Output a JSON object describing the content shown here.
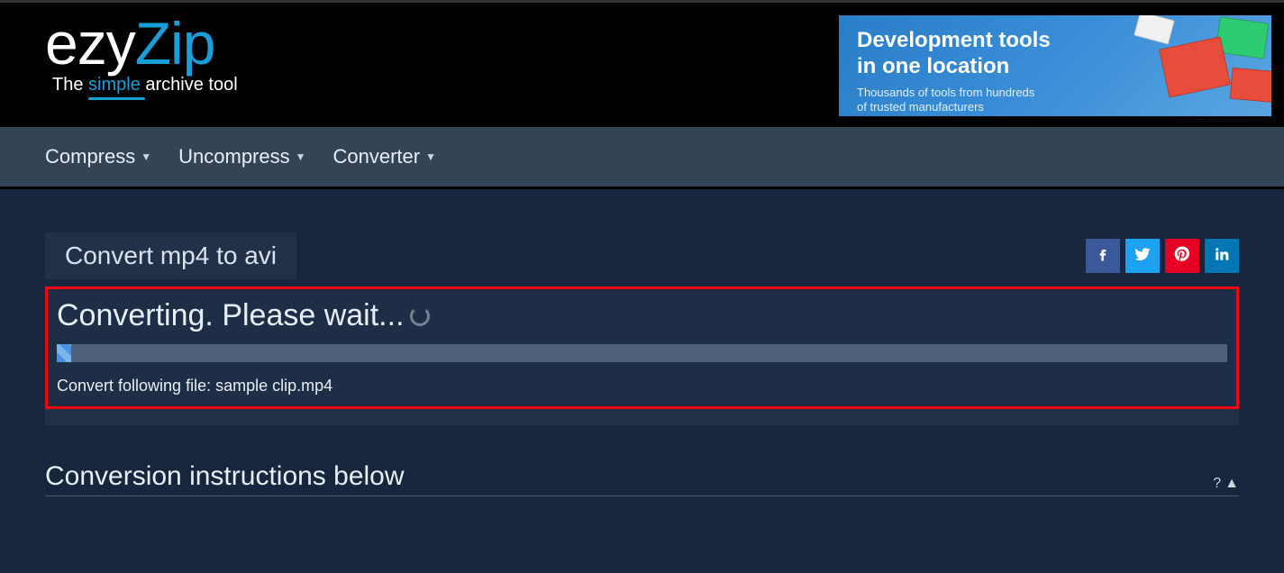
{
  "logo": {
    "part1": "ezy",
    "part2": "Zip"
  },
  "tagline": {
    "prefix": "The ",
    "highlight": "simple",
    "suffix": " archive tool"
  },
  "ad": {
    "title_line1": "Development tools",
    "title_line2": "in one location",
    "sub_line1": "Thousands of tools from hundreds",
    "sub_line2": "of trusted manufacturers"
  },
  "nav": {
    "compress": "Compress",
    "uncompress": "Uncompress",
    "converter": "Converter"
  },
  "page_title": "Convert mp4 to avi",
  "status": {
    "heading": "Converting. Please wait...",
    "progress_percent": 1.2,
    "file_line": "Convert following file: sample clip.mp4"
  },
  "instructions": {
    "title": "Conversion instructions below",
    "toggle_label": "?"
  },
  "social": {
    "facebook": "facebook",
    "twitter": "twitter",
    "pinterest": "pinterest",
    "linkedin": "linkedin"
  }
}
